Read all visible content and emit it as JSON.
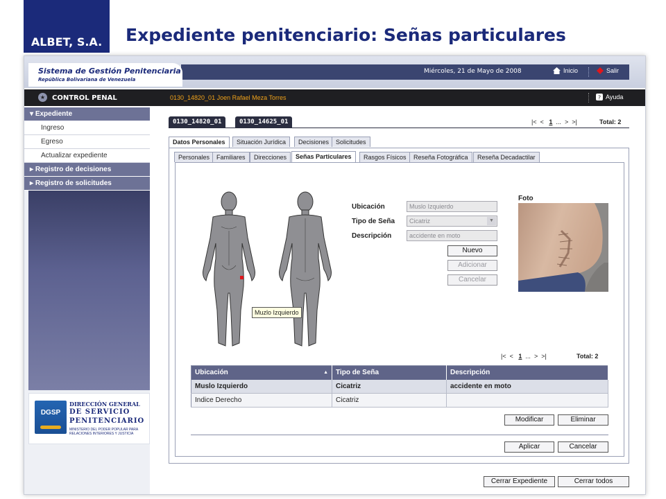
{
  "slide": {
    "brand": "ALBET, S.A.",
    "title": "Expediente penitenciario: Señas particulares"
  },
  "app": {
    "system_name": "Sistema de Gestión Penitenciaria",
    "country": "República Bolivariana de Venezuela",
    "date": "Miércoles, 21 de Mayo de 2008",
    "inicio_label": "Inicio",
    "salir_label": "Salir",
    "module": "CONTROL PENAL",
    "inmate": "0130_14820_01 Joen Rafael Meza Torres",
    "help_label": "Ayuda"
  },
  "sidebar": {
    "section": "Expediente",
    "items": [
      "Ingreso",
      "Egreso",
      "Actualizar expediente"
    ],
    "collapsed": [
      "Registro de decisiones",
      "Registro de solicitudes"
    ],
    "logo": {
      "mark": "DGSP",
      "line1": "DIRECCIÓN GENERAL",
      "line2": "DE SERVICIO",
      "line3": "PENITENCIARIO",
      "line4": "MINISTERIO DEL PODER POPULAR PARA RELACIONES INTERIORES Y JUSTICIA"
    }
  },
  "cases": {
    "tabs": [
      "0130_14820_01",
      "0130_14625_01"
    ],
    "pager": {
      "first": "|<",
      "prev": "<",
      "page": "1",
      "more": "...",
      "next": ">",
      "last": ">|",
      "total": "Total: 2"
    }
  },
  "tabs_main": [
    "Datos Personales",
    "Situación Jurídica",
    "Decisiones",
    "Solicitudes"
  ],
  "tabs_sub": [
    "Personales",
    "Familiares",
    "Direcciones",
    "Señas Particulares",
    "Rasgos Físicos",
    "Reseña Fotográfica",
    "Reseña Decadactilar"
  ],
  "body_map": {
    "tooltip": "Muzlo Izquierdo"
  },
  "form": {
    "ubicacion_label": "Ubicación",
    "ubicacion_value": "Muslo Izquierdo",
    "tipo_label": "Tipo de Seña",
    "tipo_value": "Cicatriz",
    "descripcion_label": "Descripción",
    "descripcion_value": "accidente en moto",
    "nuevo": "Nuevo",
    "adicionar": "Adicionar",
    "cancelar": "Cancelar"
  },
  "foto": {
    "label": "Foto"
  },
  "table": {
    "pager": {
      "first": "|<",
      "prev": "<",
      "page": "1",
      "more": "...",
      "next": ">",
      "last": ">|",
      "total": "Total: 2"
    },
    "headers": [
      "Ubicación",
      "Tipo de Seña",
      "Descripción"
    ],
    "rows": [
      [
        "Muslo Izquierdo",
        "Cicatriz",
        "accidente en moto"
      ],
      [
        "Indice Derecho",
        "Cicatriz",
        ""
      ]
    ]
  },
  "buttons": {
    "modificar": "Modificar",
    "eliminar": "Eliminar",
    "aplicar": "Aplicar",
    "cancelar": "Cancelar",
    "cerrar_expediente": "Cerrar Expediente",
    "cerrar_todos": "Cerrar todos"
  },
  "colors": {
    "brand": "#1b2a7a",
    "nav": "#6d7296",
    "accent": "#f0a21a",
    "marker": "#e0161b"
  }
}
